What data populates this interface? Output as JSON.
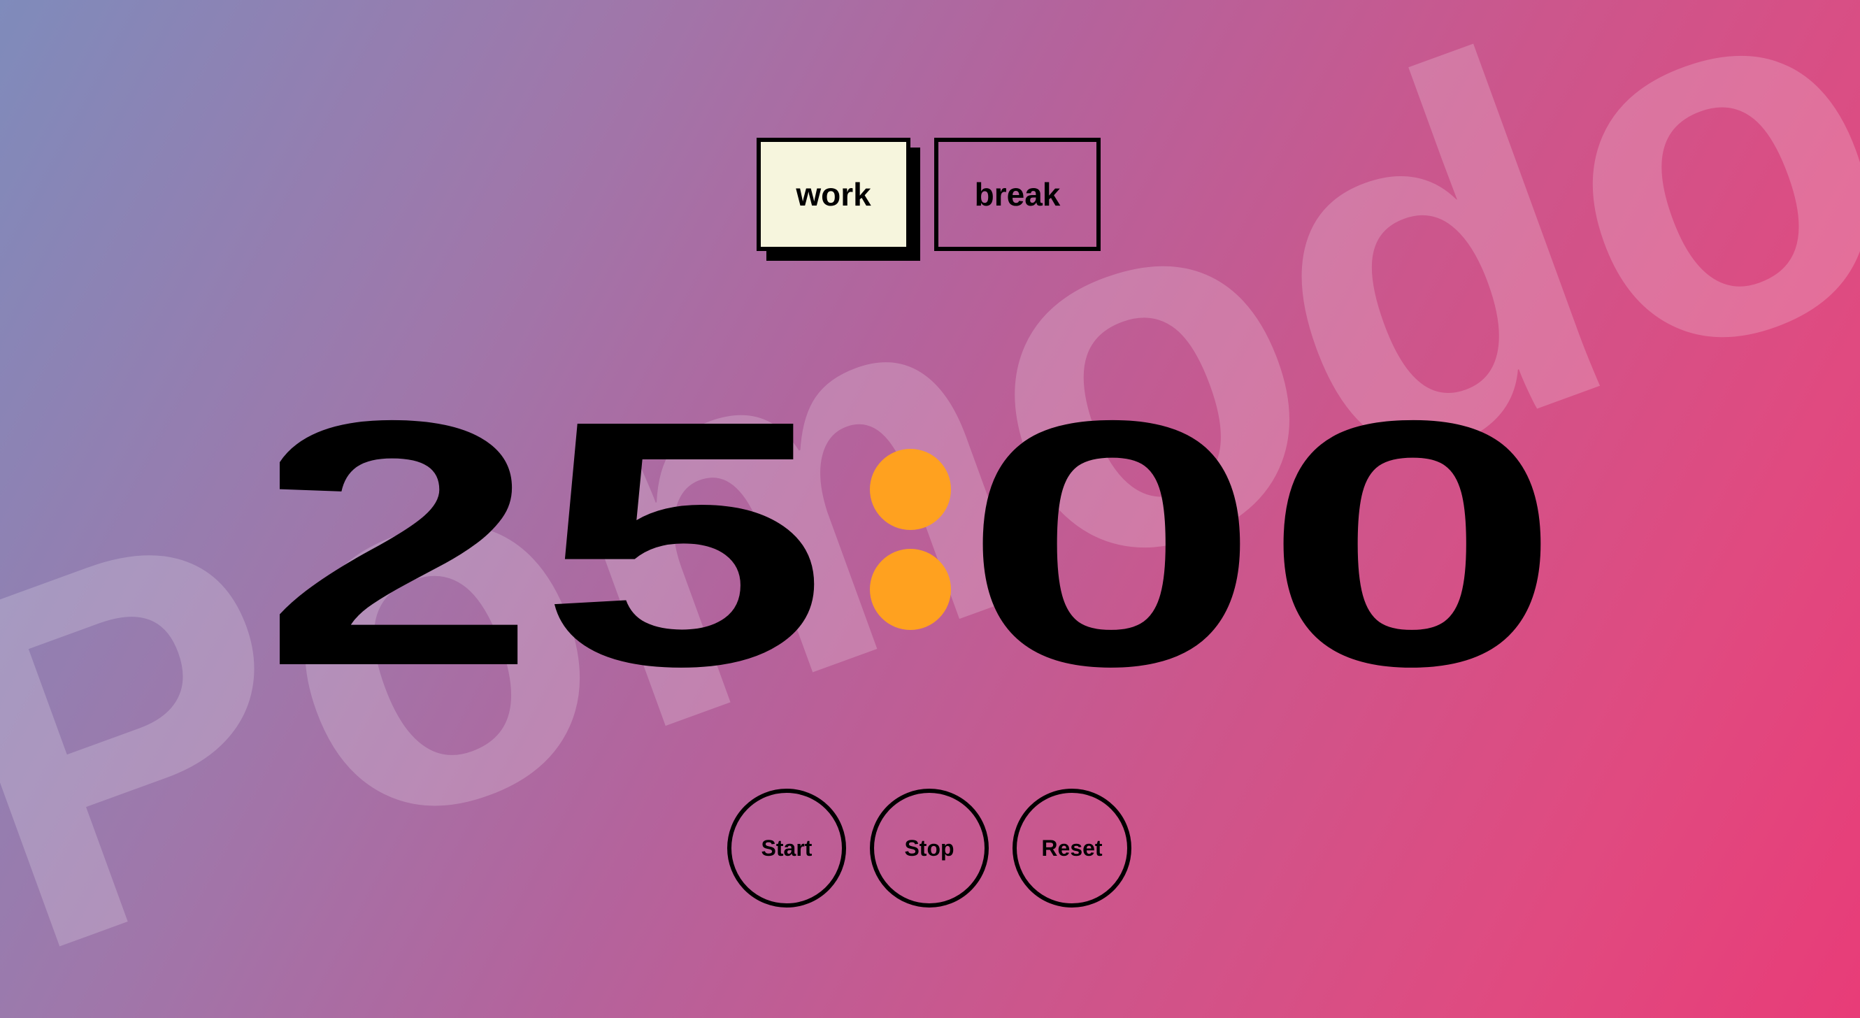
{
  "watermark": {
    "text": "Pomodoro"
  },
  "mode": {
    "work_label": "work",
    "break_label": "break",
    "active": "work"
  },
  "timer": {
    "minutes": "25",
    "seconds": "00",
    "separator_color": "#ffa11f"
  },
  "controls": {
    "start_label": "Start",
    "stop_label": "Stop",
    "reset_label": "Reset"
  },
  "colors": {
    "active_tab_bg": "#f6f5dd",
    "gradient_start": "#7f8bbb",
    "gradient_end": "#e83c78"
  }
}
